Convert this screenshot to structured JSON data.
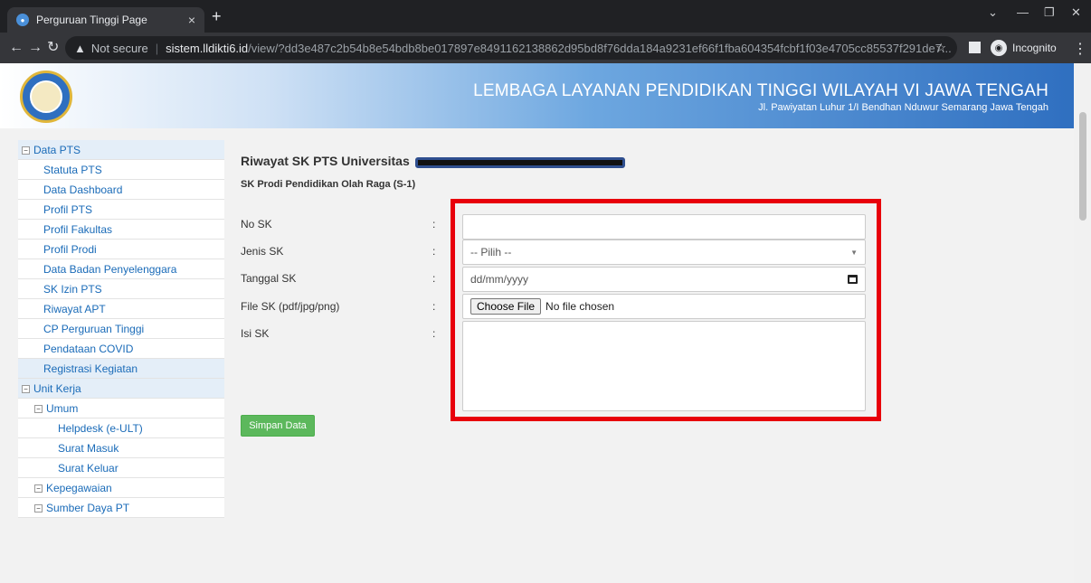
{
  "browser": {
    "tab_title": "Perguruan Tinggi Page",
    "tab_close": "×",
    "new_tab": "+",
    "not_secure": "Not secure",
    "host": "sistem.lldikti6.id",
    "path": "/view/?dd3e487c2b54b8e54bdb8be017897e8491162138862d95bd8f76dda184a9231ef66f1fba604354fcbf1f03e4705cc85537f291de7...",
    "incognito_label": "Incognito",
    "icons": [
      "back-icon",
      "forward-icon",
      "reload-icon",
      "warning-icon",
      "star-icon",
      "side-panel-icon",
      "incognito-icon",
      "kebab-menu-icon"
    ]
  },
  "header": {
    "title": "LEMBAGA LAYANAN PENDIDIKAN TINGGI WILAYAH VI JAWA TENGAH",
    "address": "Jl. Pawiyatan Luhur 1/I Bendhan Nduwur Semarang Jawa Tengah"
  },
  "sidebar": {
    "items": [
      {
        "label": "Data PTS",
        "type": "group"
      },
      {
        "label": "Statuta PTS",
        "type": "child"
      },
      {
        "label": "Data Dashboard",
        "type": "child"
      },
      {
        "label": "Profil PTS",
        "type": "child"
      },
      {
        "label": "Profil Fakultas",
        "type": "child"
      },
      {
        "label": "Profil Prodi",
        "type": "child"
      },
      {
        "label": "Data Badan Penyelenggara",
        "type": "child"
      },
      {
        "label": "SK Izin PTS",
        "type": "child"
      },
      {
        "label": "Riwayat APT",
        "type": "child"
      },
      {
        "label": "CP Perguruan Tinggi",
        "type": "child"
      },
      {
        "label": "Pendataan COVID",
        "type": "child"
      },
      {
        "label": "Registrasi Kegiatan",
        "type": "top"
      },
      {
        "label": "Unit Kerja",
        "type": "group"
      },
      {
        "label": "Umum",
        "type": "subgroup"
      },
      {
        "label": "Helpdesk (e-ULT)",
        "type": "grandchild"
      },
      {
        "label": "Surat Masuk",
        "type": "grandchild"
      },
      {
        "label": "Surat Keluar",
        "type": "grandchild"
      },
      {
        "label": "Kepegawaian",
        "type": "subgroup"
      },
      {
        "label": "Sumber Daya PT",
        "type": "subgroup"
      }
    ]
  },
  "main": {
    "title": "Riwayat SK PTS Universitas",
    "subtitle": "SK Prodi Pendidikan Olah Raga (S-1)",
    "form": {
      "no_sk_label": "No SK",
      "no_sk_value": "",
      "jenis_sk_label": "Jenis SK",
      "jenis_sk_selected": "-- Pilih --",
      "tanggal_sk_label": "Tanggal SK",
      "tanggal_sk_placeholder": "dd/mm/yyyy",
      "file_sk_label": "File SK (pdf/jpg/png)",
      "file_button": "Choose File",
      "file_status": "No file chosen",
      "isi_sk_label": "Isi SK",
      "isi_sk_value": "",
      "colon": ":",
      "save_label": "Simpan Data"
    }
  },
  "colors": {
    "highlight": "#e8000b",
    "save_button": "#5cb85c",
    "link": "#1a6bb8"
  }
}
